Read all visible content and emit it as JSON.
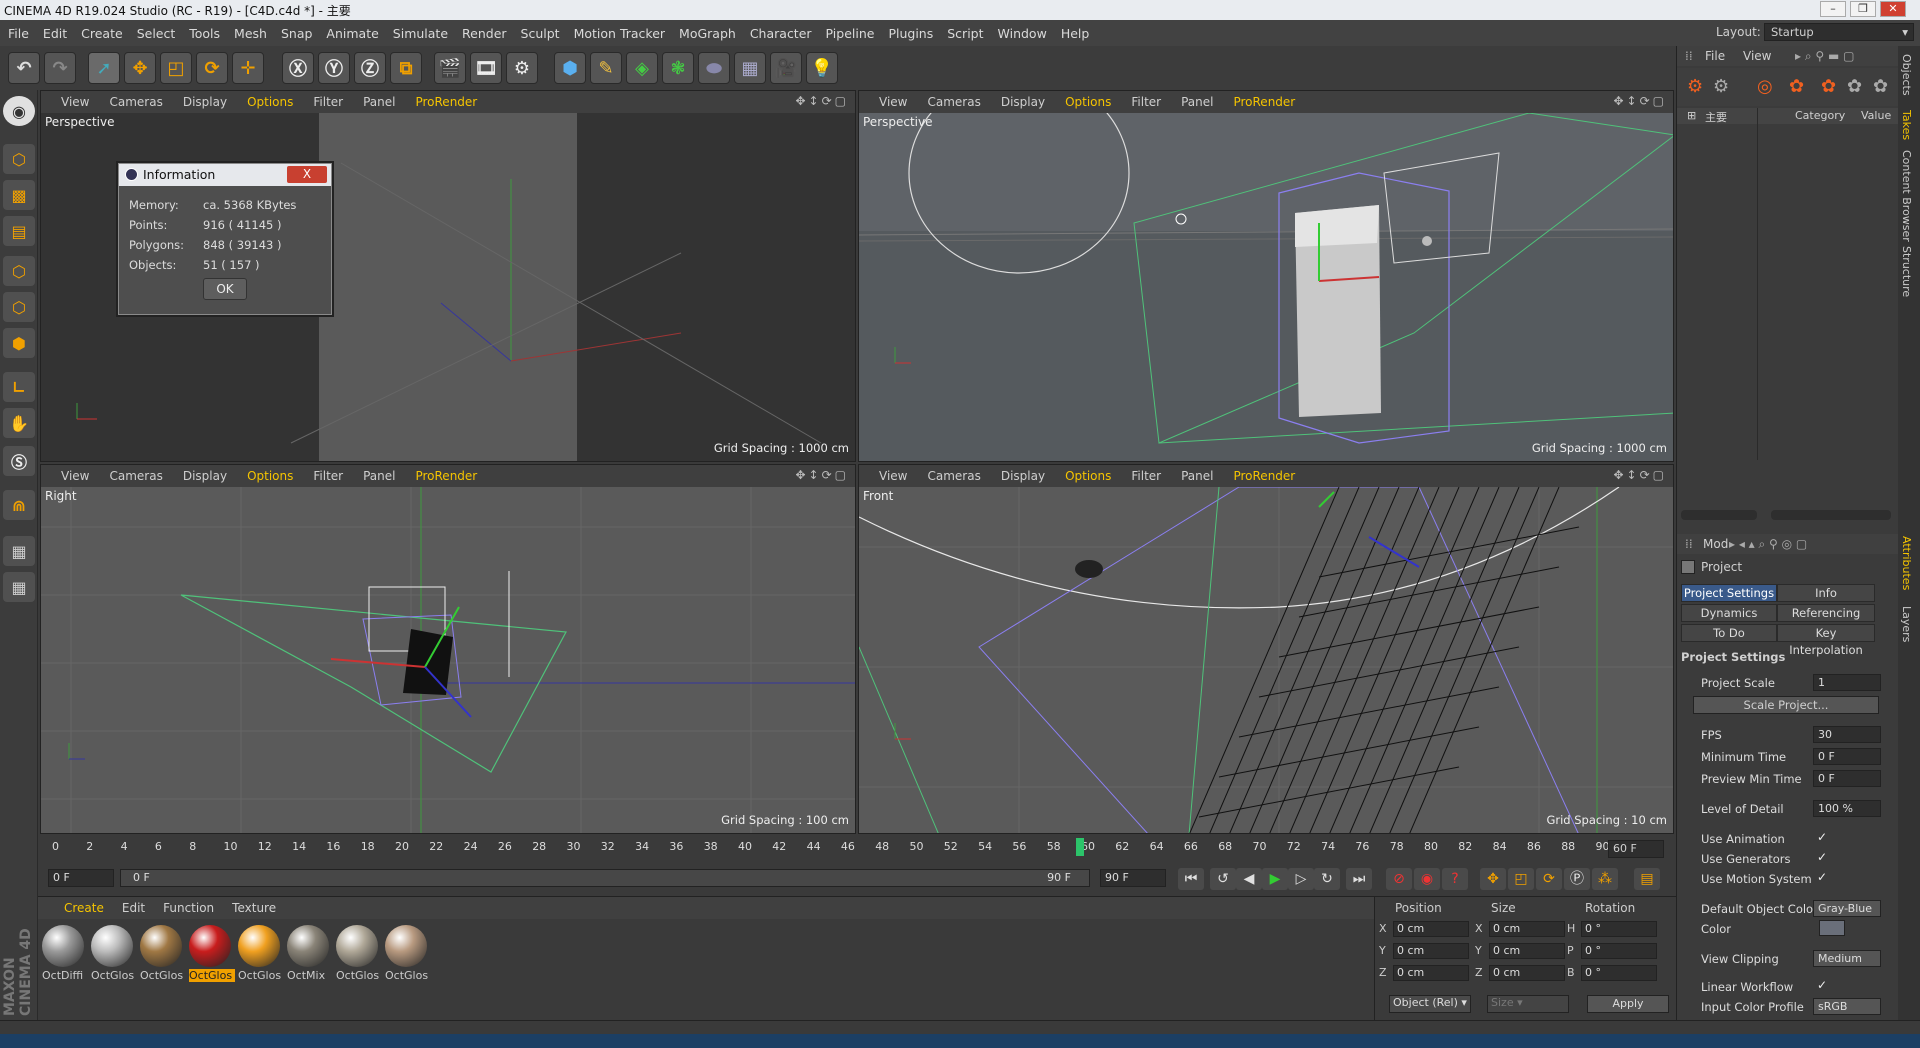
{
  "window": {
    "title": "CINEMA 4D R19.024 Studio (RC - R19) - [C4D.c4d *] - 主要"
  },
  "menu": [
    "File",
    "Edit",
    "Create",
    "Select",
    "Tools",
    "Mesh",
    "Snap",
    "Animate",
    "Simulate",
    "Render",
    "Sculpt",
    "Motion Tracker",
    "MoGraph",
    "Character",
    "Pipeline",
    "Plugins",
    "Script",
    "Window",
    "Help"
  ],
  "layout": {
    "label": "Layout:",
    "value": "Startup"
  },
  "viewport_menu": [
    "View",
    "Cameras",
    "Display",
    "Options",
    "Filter",
    "Panel",
    "ProRender"
  ],
  "viewports": [
    {
      "label": "Perspective",
      "grid": "Grid Spacing : 1000 cm"
    },
    {
      "label": "Perspective",
      "grid": "Grid Spacing : 1000 cm"
    },
    {
      "label": "Right",
      "grid": "Grid Spacing : 100 cm"
    },
    {
      "label": "Front",
      "grid": "Grid Spacing : 10 cm"
    }
  ],
  "info_dialog": {
    "title": "Information",
    "close": "X",
    "rows": [
      {
        "k": "Memory:",
        "v": "ca. 5368 KBytes"
      },
      {
        "k": "Points:",
        "v": "916 ( 41145 )"
      },
      {
        "k": "Polygons:",
        "v": "848 ( 39143 )"
      },
      {
        "k": "Objects:",
        "v": "51 ( 157 )"
      }
    ],
    "ok": "OK"
  },
  "timeline": {
    "ticks": [
      "0",
      "2",
      "4",
      "6",
      "8",
      "10",
      "12",
      "14",
      "16",
      "18",
      "20",
      "22",
      "24",
      "26",
      "28",
      "30",
      "32",
      "34",
      "36",
      "38",
      "40",
      "42",
      "44",
      "46",
      "48",
      "50",
      "52",
      "54",
      "56",
      "58",
      "60",
      "62",
      "64",
      "66",
      "68",
      "70",
      "72",
      "74",
      "76",
      "78",
      "80",
      "82",
      "84",
      "86",
      "88",
      "90"
    ],
    "end_label": "60 F",
    "current": "0 F",
    "range_start": "0 F",
    "range_end": "90 F",
    "max": "90 F"
  },
  "material_menu": [
    "Create",
    "Edit",
    "Function",
    "Texture"
  ],
  "materials": [
    {
      "name": "OctDiffi",
      "color": "#9a9a9a"
    },
    {
      "name": "OctGlos",
      "color": "#bcbcbc"
    },
    {
      "name": "OctGlos",
      "color": "#a07844"
    },
    {
      "name": "OctGlos",
      "color": "#c81d1d"
    },
    {
      "name": "OctGlos",
      "color": "#f0a020"
    },
    {
      "name": "OctMix",
      "color": "#8a8478"
    },
    {
      "name": "OctGlos",
      "color": "#b0a898"
    },
    {
      "name": "OctGlos",
      "color": "#b89a80"
    }
  ],
  "coords": {
    "headers": [
      "Position",
      "Size",
      "Rotation"
    ],
    "rows": [
      {
        "a": "X",
        "p": "0 cm",
        "b": "X",
        "s": "0 cm",
        "c": "H",
        "r": "0 °"
      },
      {
        "a": "Y",
        "p": "0 cm",
        "b": "Y",
        "s": "0 cm",
        "c": "P",
        "r": "0 °"
      },
      {
        "a": "Z",
        "p": "0 cm",
        "b": "Z",
        "s": "0 cm",
        "c": "B",
        "r": "0 °"
      }
    ],
    "mode": "Object (Rel)",
    "size_mode": "Size",
    "apply": "Apply"
  },
  "objects_panel": {
    "menu": [
      "File",
      "View"
    ],
    "root": "主要",
    "cols": [
      "Category",
      "Value"
    ]
  },
  "attributes": {
    "mode": "Mod",
    "object": "Project",
    "tabs": [
      "Project Settings",
      "Info",
      "Dynamics",
      "Referencing",
      "To Do",
      "Key Interpolation"
    ],
    "section": "Project Settings",
    "project_scale": {
      "label": "Project Scale",
      "value": "1"
    },
    "scale_btn": "Scale Project...",
    "fps": {
      "label": "FPS",
      "value": "30"
    },
    "min_time": {
      "label": "Minimum Time",
      "value": "0 F"
    },
    "preview_min": {
      "label": "Preview Min Time",
      "value": "0 F"
    },
    "lod": {
      "label": "Level of Detail",
      "value": "100 %"
    },
    "use_anim": "Use Animation",
    "use_gen": "Use Generators",
    "use_motion": "Use Motion System",
    "def_color": {
      "label": "Default Object Color",
      "value": "Gray-Blue"
    },
    "color": "Color",
    "view_clip": {
      "label": "View Clipping",
      "value": "Medium"
    },
    "linear": "Linear Workflow",
    "input_profile": {
      "label": "Input Color Profile",
      "value": "sRGB"
    },
    "check": "✓"
  },
  "side_tabs": [
    "Objects",
    "Takes",
    "Content Browser",
    "Structure",
    "Attributes",
    "Layers"
  ],
  "brand": "MAXON CINEMA 4D"
}
